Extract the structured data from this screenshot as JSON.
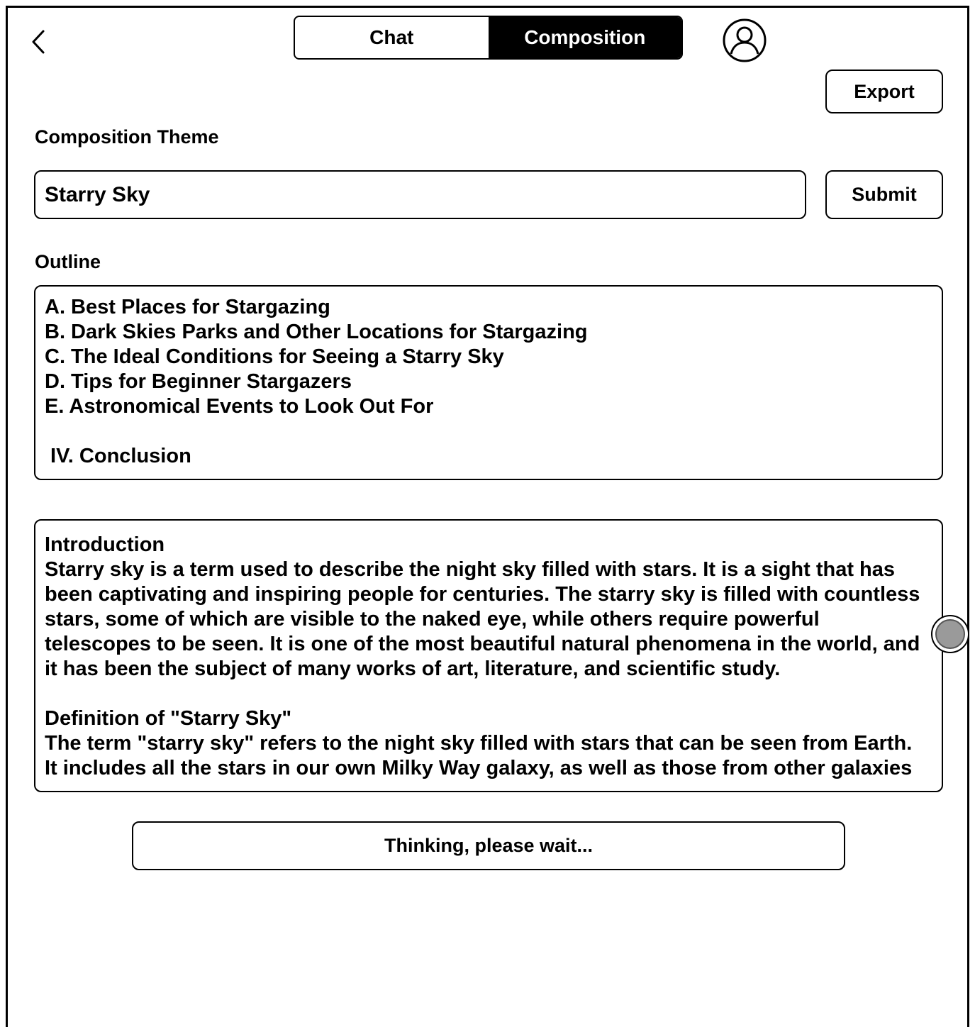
{
  "header": {
    "tabs": [
      {
        "label": "Chat",
        "active": false
      },
      {
        "label": "Composition",
        "active": true
      }
    ],
    "back_icon": "chevron-left-icon",
    "avatar_icon": "user-icon"
  },
  "toolbar": {
    "export_label": "Export"
  },
  "theme": {
    "label": "Composition Theme",
    "value": "Starry Sky",
    "submit_label": "Submit"
  },
  "outline": {
    "label": "Outline",
    "lines": [
      "A. Best Places for Stargazing",
      "B. Dark Skies Parks and Other Locations for Stargazing",
      "C. The Ideal Conditions for Seeing a Starry Sky",
      "D. Tips for Beginner Stargazers",
      "E. Astronomical Events to Look Out For",
      "",
      " IV. Conclusion"
    ]
  },
  "composition": {
    "sections": [
      {
        "heading": "Introduction",
        "body": "Starry sky is a term used to describe the night sky filled with stars. It is a sight that has been captivating and inspiring people for centuries. The starry sky is filled with countless stars, some of which are visible to the naked eye, while others require powerful telescopes to be seen. It is one of the most beautiful natural phenomena in the world, and it has been the subject of many works of art, literature, and scientific study."
      },
      {
        "heading": "Definition of \"Starry Sky\"",
        "body": "The term \"starry sky\" refers to the night sky filled with stars that can be seen from Earth. It includes all the stars in our own Milky Way galaxy, as well as those from other galaxies"
      }
    ]
  },
  "status": {
    "label": "Thinking, please wait..."
  }
}
